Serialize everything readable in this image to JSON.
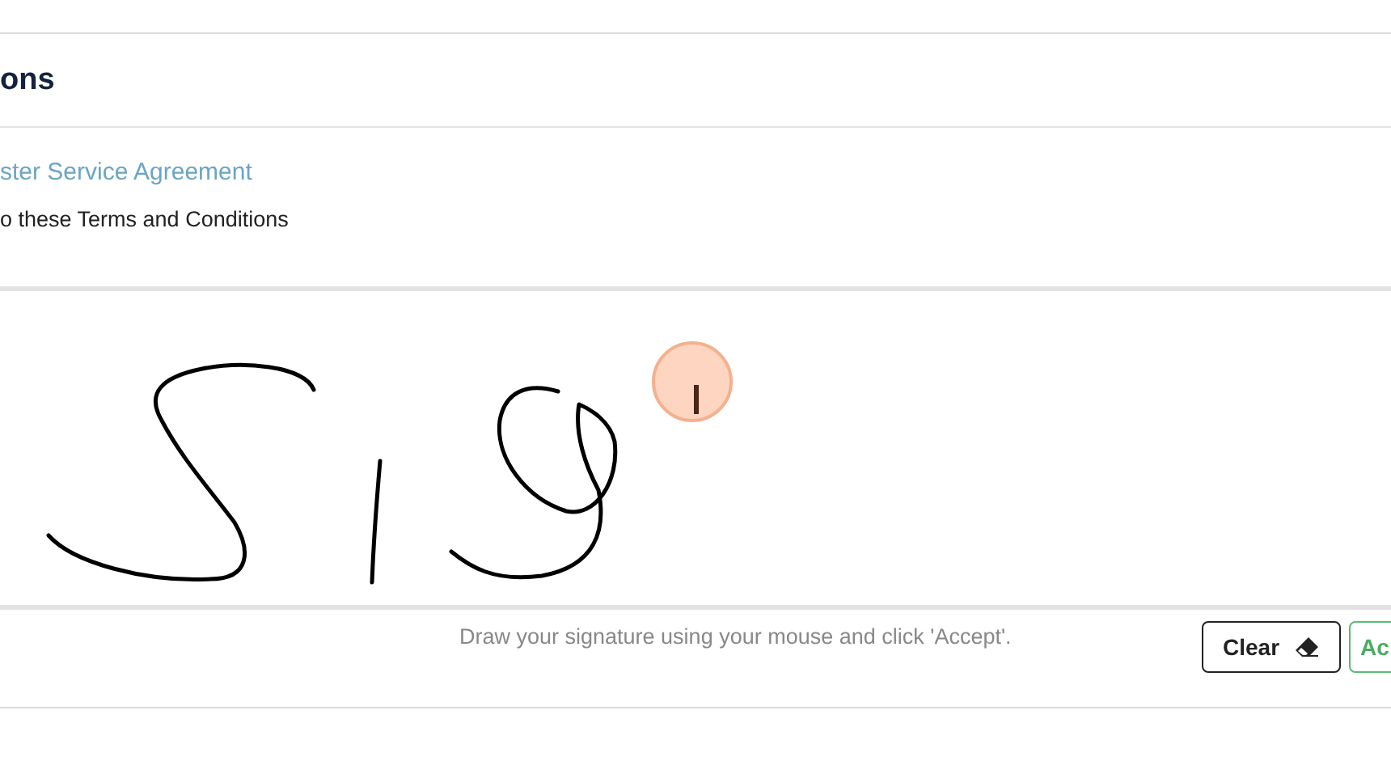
{
  "section": {
    "title": "ons"
  },
  "link": "ster Service Agreement",
  "agreement_text": "o these Terms and Conditions",
  "signature_pad": {
    "hint": "Draw your signature using your mouse and click 'Accept'.",
    "has_signature": true
  },
  "buttons": [
    {
      "kind": "clear",
      "label": "Clear"
    },
    {
      "kind": "accept",
      "label": "Ac"
    }
  ]
}
